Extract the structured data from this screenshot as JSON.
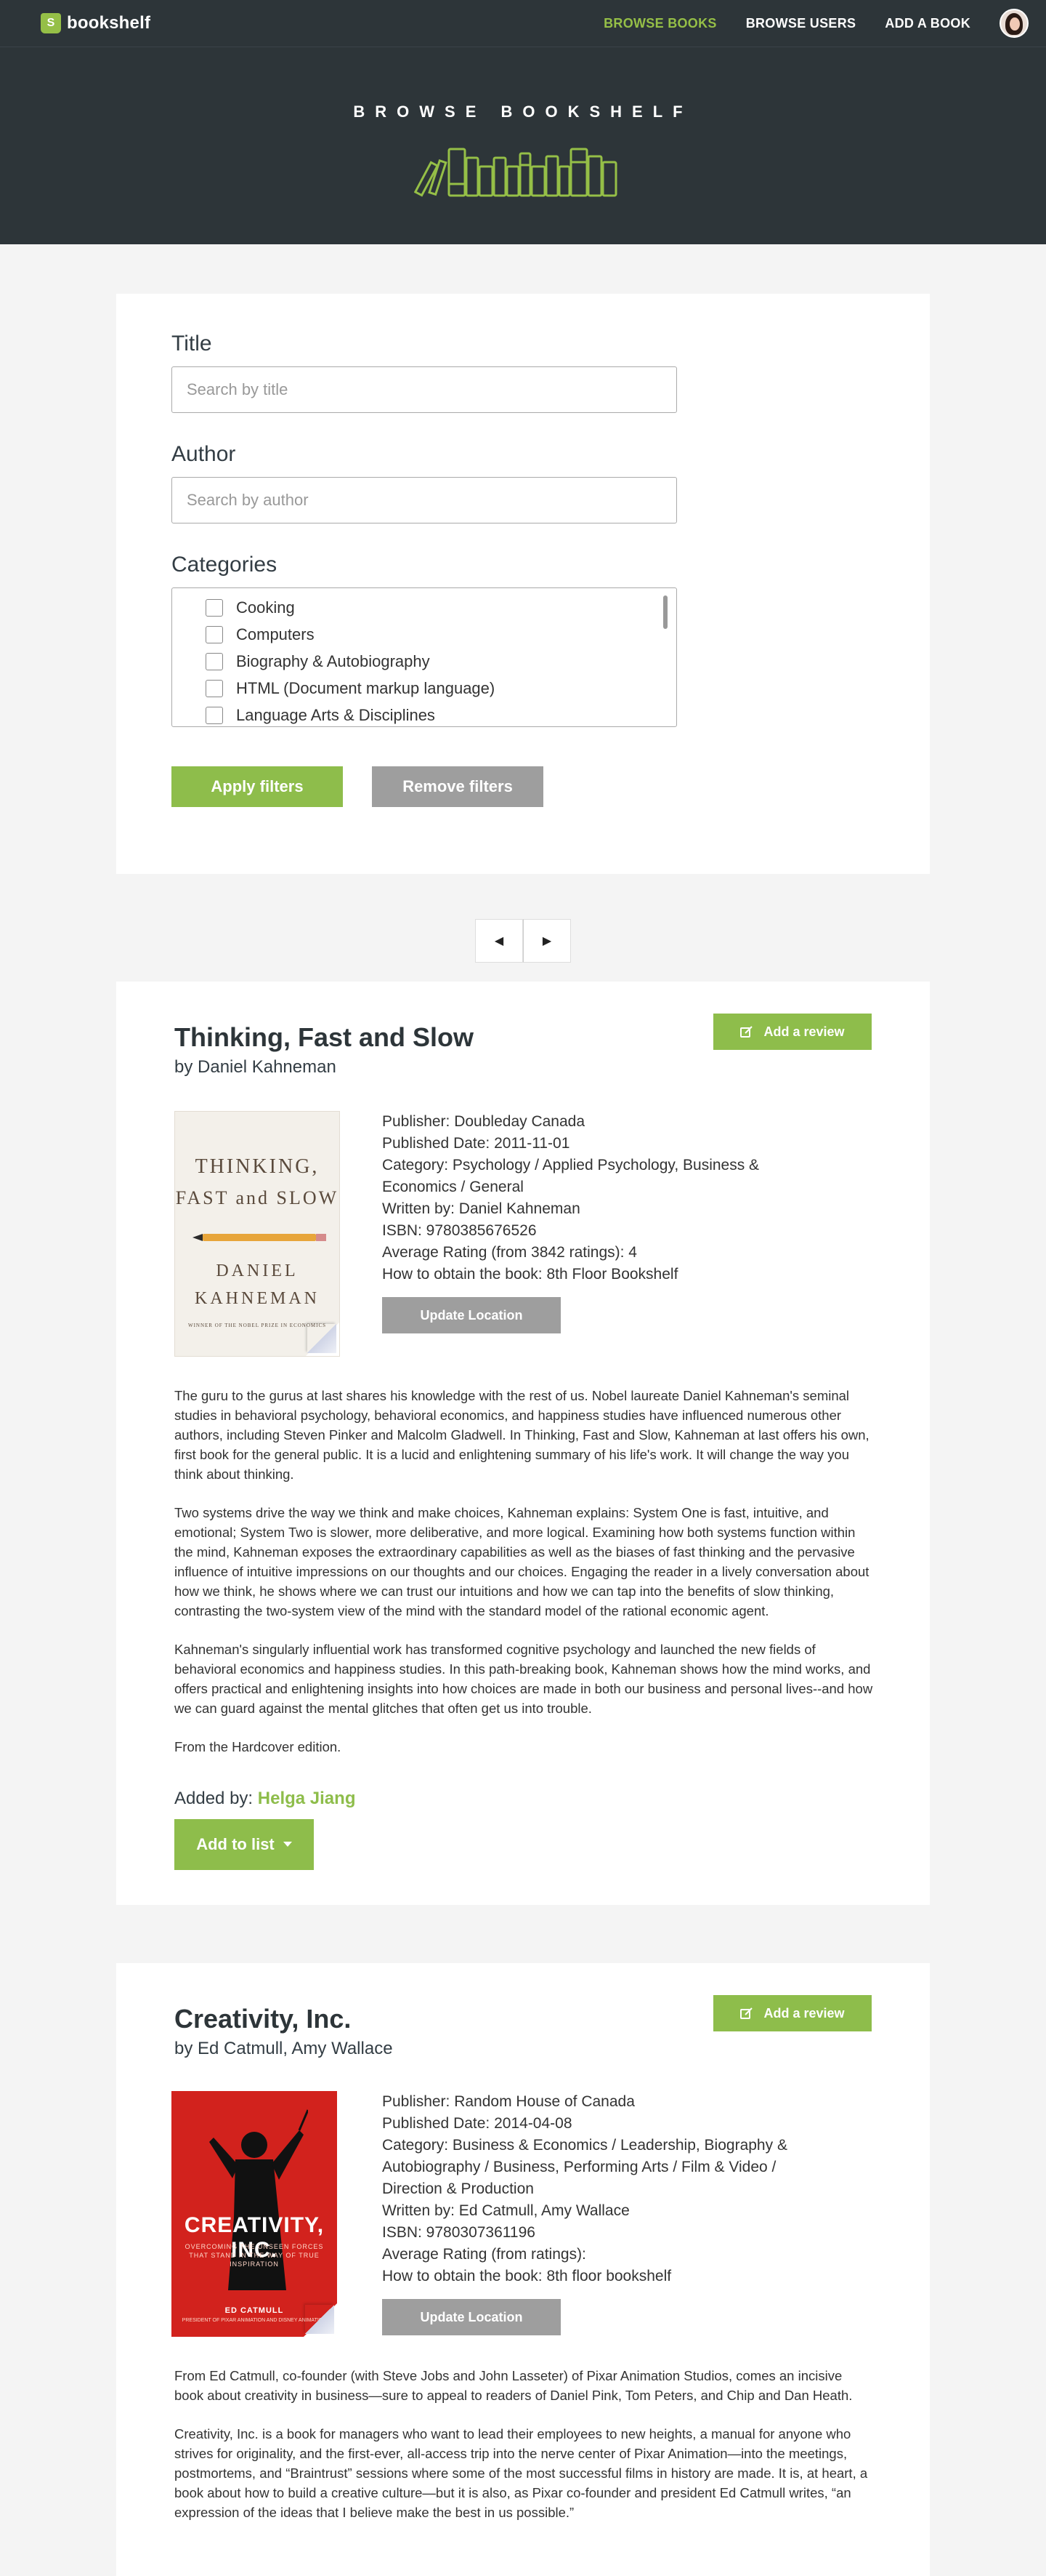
{
  "nav": {
    "brand": "bookshelf",
    "links": [
      {
        "label": "BROWSE BOOKS",
        "active": true
      },
      {
        "label": "BROWSE USERS",
        "active": false
      },
      {
        "label": "ADD A BOOK",
        "active": false
      }
    ]
  },
  "hero": {
    "title": "BROWSE BOOKSHELF"
  },
  "filters": {
    "title_label": "Title",
    "title_placeholder": "Search by title",
    "author_label": "Author",
    "author_placeholder": "Search by author",
    "categories_label": "Categories",
    "categories": [
      "Cooking",
      "Computers",
      "Biography & Autobiography",
      "HTML (Document markup language)",
      "Language Arts & Disciplines"
    ],
    "apply_label": "Apply filters",
    "remove_label": "Remove filters"
  },
  "pager": {
    "prev_icon": "◀",
    "next_icon": "▶"
  },
  "books": [
    {
      "title": "Thinking, Fast and Slow",
      "author_line": "by Daniel Kahneman",
      "review_label": "Add a review",
      "cover": {
        "line1": "THINKING,",
        "line2": "FAST and SLOW",
        "author1": "DANIEL",
        "author2": "KAHNEMAN",
        "sub": "WINNER OF THE NOBEL PRIZE IN ECONOMICS"
      },
      "meta": [
        "Publisher: Doubleday Canada",
        "Published Date: 2011-11-01",
        "Category: Psychology / Applied Psychology, Business & Economics / General",
        "Written by: Daniel Kahneman",
        "ISBN: 9780385676526",
        "Average Rating (from 3842 ratings): 4",
        "How to obtain the book: 8th Floor Bookshelf"
      ],
      "location_label": "Update Location",
      "description": [
        "The guru to the gurus at last shares his knowledge with the rest of us. Nobel laureate Daniel Kahneman's seminal studies in behavioral psychology, behavioral economics, and happiness studies have influenced numerous other authors, including Steven Pinker and Malcolm Gladwell. In Thinking, Fast and Slow, Kahneman at last offers his own, first book for the general public. It is a lucid and enlightening summary of his life's work. It will change the way you think about thinking.",
        "Two systems drive the way we think and make choices, Kahneman explains: System One is fast, intuitive, and emotional; System Two is slower, more deliberative, and more logical. Examining how both systems function within the mind, Kahneman exposes the extraordinary capabilities as well as the biases of fast thinking and the pervasive influence of intuitive impressions on our thoughts and our choices. Engaging the reader in a lively conversation about how we think, he shows where we can trust our intuitions and how we can tap into the benefits of slow thinking, contrasting the two-system view of the mind with the standard model of the rational economic agent.",
        "Kahneman's singularly influential work has transformed cognitive psychology and launched the new fields of behavioral economics and happiness studies. In this path-breaking book, Kahneman shows how the mind works, and offers practical and enlightening insights into how choices are made in both our business and personal lives--and how we can guard against the mental glitches that often get us into trouble.",
        "From the Hardcover edition."
      ],
      "added_by_label": "Added by:",
      "added_by": "Helga Jiang",
      "list_label": "Add to list"
    },
    {
      "title": "Creativity, Inc.",
      "author_line": "by Ed Catmull, Amy Wallace",
      "review_label": "Add a review",
      "cover": {
        "title": "CREATIVITY, INC.",
        "sub": "OVERCOMING THE UNSEEN FORCES THAT STAND IN THE WAY OF TRUE INSPIRATION",
        "by": "ED CATMULL",
        "by2": "PRESIDENT OF PIXAR ANIMATION AND DISNEY ANIMATION"
      },
      "meta": [
        "Publisher: Random House of Canada",
        "Published Date: 2014-04-08",
        "Category: Business & Economics / Leadership, Biography & Autobiography / Business, Performing Arts / Film & Video / Direction & Production",
        "Written by: Ed Catmull, Amy Wallace",
        "ISBN: 9780307361196",
        "Average Rating (from ratings):",
        "How to obtain the book: 8th floor bookshelf"
      ],
      "location_label": "Update Location",
      "description": [
        "From Ed Catmull, co-founder (with Steve Jobs and John Lasseter) of Pixar Animation Studios, comes an incisive book about creativity in business—sure to appeal to readers of Daniel Pink, Tom Peters, and Chip and Dan Heath.",
        "Creativity, Inc. is a book for managers who want to lead their employees to new heights, a manual for anyone who strives for originality, and the first-ever, all-access trip into the nerve center of Pixar Animation—into the meetings, postmortems, and “Braintrust” sessions where some of the most successful films in history are made. It is, at heart, a book about how to build a creative culture—but it is also, as Pixar co-founder and president Ed Catmull writes, “an expression of the ideas that I believe make the best in us possible.”"
      ]
    }
  ]
}
